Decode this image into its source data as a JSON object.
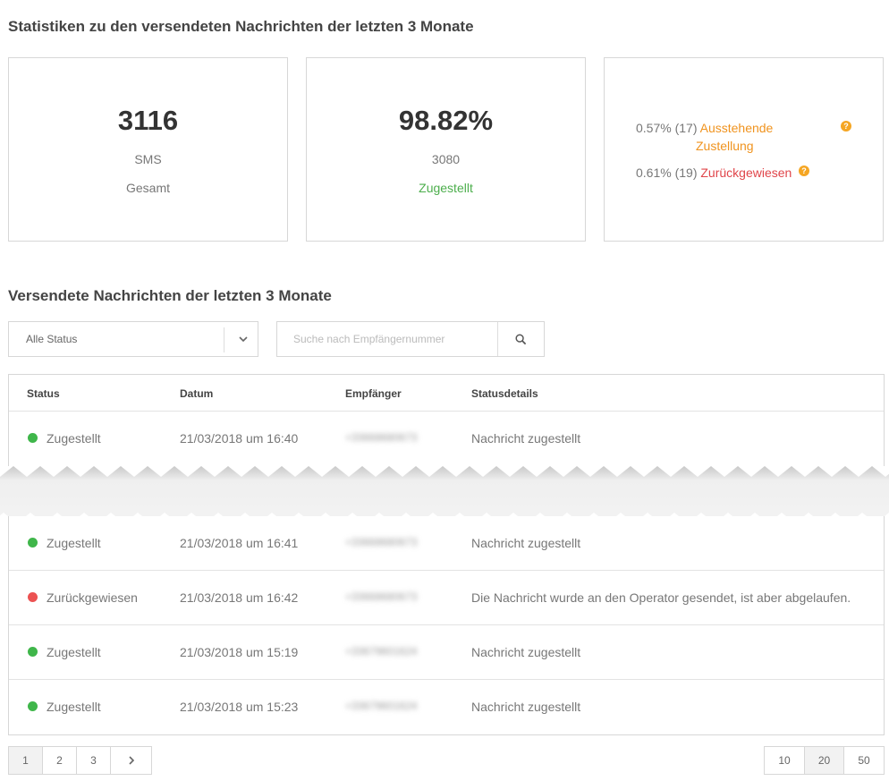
{
  "stats_section": {
    "title": "Statistiken zu den versendeten Nachrichten der letzten 3 Monate"
  },
  "cards": {
    "total": {
      "value": "3116",
      "unit": "SMS",
      "label": "Gesamt"
    },
    "delivered": {
      "value": "98.82%",
      "count": "3080",
      "label": "Zugestellt"
    },
    "other": {
      "pending": {
        "stat": "0.57% (17)",
        "label_line1": "Ausstehende",
        "label_line2": "Zustellung"
      },
      "rejected": {
        "stat": "0.61% (19)",
        "label": "Zurückgewiesen"
      }
    }
  },
  "messages_section": {
    "title": "Versendete Nachrichten der letzten 3 Monate"
  },
  "filter": {
    "selected": "Alle Status"
  },
  "search": {
    "placeholder": "Suche nach Empfängernummer"
  },
  "table": {
    "headers": {
      "status": "Status",
      "date": "Datum",
      "recipient": "Empfänger",
      "details": "Statusdetails"
    },
    "rows": [
      {
        "status": "Zugestellt",
        "date": "21/03/2018 um 16:40",
        "recipient": "+33668680673",
        "details": "Nachricht zugestellt"
      },
      {
        "status": "Zugestellt",
        "date": "21/03/2018 um 16:41",
        "recipient": "+33668680673",
        "details": "Nachricht zugestellt"
      },
      {
        "status": "Zurückgewiesen",
        "date": "21/03/2018 um 16:42",
        "recipient": "+33668680673",
        "details": "Die Nachricht wurde an den Operator gesendet, ist aber abgelaufen."
      },
      {
        "status": "Zugestellt",
        "date": "21/03/2018 um 15:19",
        "recipient": "+33679601624",
        "details": "Nachricht zugestellt"
      },
      {
        "status": "Zugestellt",
        "date": "21/03/2018 um 15:23",
        "recipient": "+33679601624",
        "details": "Nachricht zugestellt"
      }
    ]
  },
  "pagination": {
    "pages": [
      "1",
      "2",
      "3"
    ],
    "current": "1"
  },
  "page_size": {
    "options": [
      "10",
      "20",
      "50"
    ],
    "selected": "20"
  },
  "colors": {
    "delivered": "#3fb64a",
    "rejected": "#ec5252",
    "pending": "#f0931e",
    "help_icon": "#f5a623"
  }
}
